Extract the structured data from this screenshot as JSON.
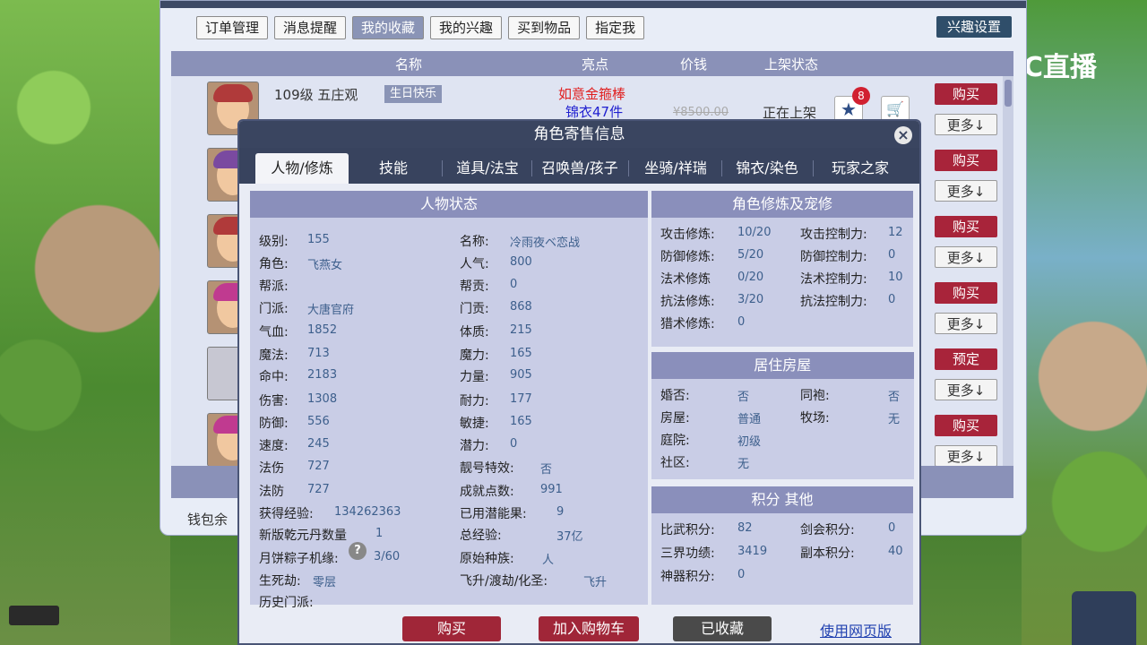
{
  "nav": {
    "tabs": [
      "订单管理",
      "消息提醒",
      "我的收藏",
      "我的兴趣",
      "买到物品",
      "指定我"
    ],
    "active_index": 2,
    "interest_settings": "兴趣设置"
  },
  "list": {
    "columns": [
      "名称",
      "亮点",
      "价钱",
      "上架状态"
    ],
    "row1": {
      "level_school": "109级  五庄观",
      "birthday_badge": "生日快乐",
      "highlight_1": "如意金箍棒",
      "highlight_2": "锦衣47件",
      "price": "¥8500.00",
      "status": "正在上架",
      "fav_count": "8"
    },
    "buy_label": "购买",
    "reserve_label": "预定",
    "more_label": "更多↓"
  },
  "wallet_label": "钱包余",
  "brand": {
    "logo_text": "CC直播"
  },
  "modal": {
    "title": "角色寄售信息",
    "tabs": [
      "人物/修炼",
      "技能",
      "道具/法宝",
      "召唤兽/孩子",
      "坐骑/祥瑞",
      "锦衣/染色",
      "玩家之家"
    ],
    "active_tab_index": 0,
    "panels": {
      "character_status": "人物状态",
      "cultivation": "角色修炼及宠修",
      "residence": "居住房屋",
      "points": "积分 其他"
    },
    "char_left": [
      {
        "label": "级别:",
        "value": "155"
      },
      {
        "label": "角色:",
        "value": "飞燕女"
      },
      {
        "label": "帮派:",
        "value": ""
      },
      {
        "label": "门派:",
        "value": "大唐官府"
      },
      {
        "label": "气血:",
        "value": "1852"
      },
      {
        "label": "魔法:",
        "value": "713"
      },
      {
        "label": "命中:",
        "value": "2183"
      },
      {
        "label": "伤害:",
        "value": "1308"
      },
      {
        "label": "防御:",
        "value": "556"
      },
      {
        "label": "速度:",
        "value": "245"
      },
      {
        "label": "法伤",
        "value": "727"
      },
      {
        "label": "法防",
        "value": "727"
      },
      {
        "label": "获得经验:",
        "value": "134262363"
      },
      {
        "label": "新版乾元丹数量",
        "value": "1"
      },
      {
        "label": "月饼粽子机缘:",
        "value": "3/60"
      },
      {
        "label": "生死劫:",
        "value": "零层"
      },
      {
        "label": "历史门派:",
        "value": ""
      }
    ],
    "char_right": [
      {
        "label": "名称:",
        "value": "冷雨夜ベ恋战"
      },
      {
        "label": "人气:",
        "value": "800"
      },
      {
        "label": "帮贡:",
        "value": "0"
      },
      {
        "label": "门贡:",
        "value": "868"
      },
      {
        "label": "体质:",
        "value": "215"
      },
      {
        "label": "魔力:",
        "value": "165"
      },
      {
        "label": "力量:",
        "value": "905"
      },
      {
        "label": "耐力:",
        "value": "177"
      },
      {
        "label": "敏捷:",
        "value": "165"
      },
      {
        "label": "潜力:",
        "value": "0"
      },
      {
        "label": "靓号特效:",
        "value": "否"
      },
      {
        "label": "成就点数:",
        "value": "991"
      },
      {
        "label": "已用潜能果:",
        "value": "9"
      },
      {
        "label": "总经验:",
        "value": "37亿"
      },
      {
        "label": "原始种族:",
        "value": "人"
      },
      {
        "label": "飞升/渡劫/化圣:",
        "value": "飞升"
      }
    ],
    "cultivation_rows": [
      {
        "l1": "攻击修炼:",
        "v1": "10/20",
        "l2": "攻击控制力:",
        "v2": "12"
      },
      {
        "l1": "防御修炼:",
        "v1": "5/20",
        "l2": "防御控制力:",
        "v2": "0"
      },
      {
        "l1": "法术修炼",
        "v1": "0/20",
        "l2": "法术控制力:",
        "v2": "10"
      },
      {
        "l1": "抗法修炼:",
        "v1": "3/20",
        "l2": "抗法控制力:",
        "v2": "0"
      },
      {
        "l1": "猎术修炼:",
        "v1": "0",
        "l2": "",
        "v2": ""
      }
    ],
    "residence_rows": [
      {
        "l1": "婚否:",
        "v1": "否",
        "l2": "同袍:",
        "v2": "否"
      },
      {
        "l1": "房屋:",
        "v1": "普通",
        "l2": "牧场:",
        "v2": "无"
      },
      {
        "l1": "庭院:",
        "v1": "初级",
        "l2": "",
        "v2": ""
      },
      {
        "l1": "社区:",
        "v1": "无",
        "l2": "",
        "v2": ""
      }
    ],
    "points_rows": [
      {
        "l1": "比武积分:",
        "v1": "82",
        "l2": "剑会积分:",
        "v2": "0"
      },
      {
        "l1": "三界功绩:",
        "v1": "3419",
        "l2": "副本积分:",
        "v2": "40"
      },
      {
        "l1": "神器积分:",
        "v1": "0",
        "l2": "",
        "v2": ""
      }
    ],
    "footer": {
      "buy": "购买",
      "add_cart": "加入购物车",
      "favorited": "已收藏",
      "web_link": "使用网页版"
    }
  }
}
